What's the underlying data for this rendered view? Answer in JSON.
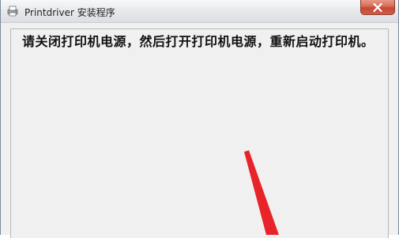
{
  "window": {
    "title": "Printdriver 安装程序",
    "icon": "printer-setup-icon"
  },
  "titlebar": {
    "close_icon": "close-icon"
  },
  "dialog": {
    "message": "请关闭打印机电源，然后打开打印机电源，重新启动打印机。"
  },
  "colors": {
    "close_button": "#c74632",
    "annotation_arrow": "#e8232a",
    "window_background": "#f0f0f0"
  }
}
